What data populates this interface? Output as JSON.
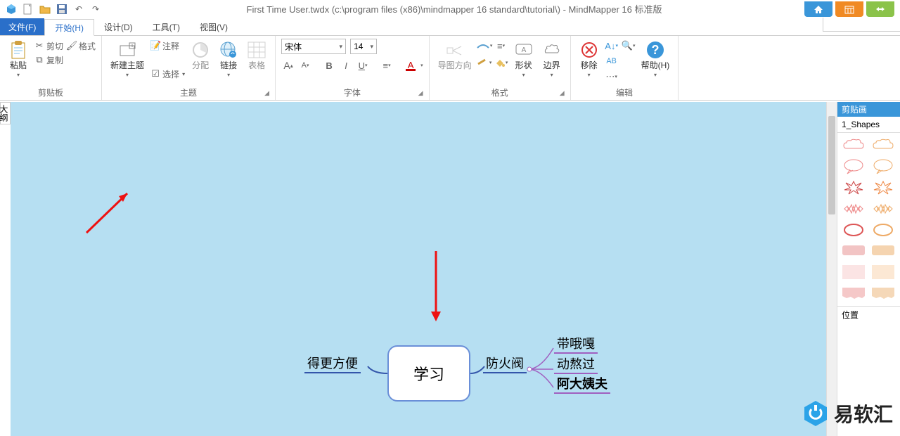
{
  "title": "First Time User.twdx (c:\\program files (x86)\\mindmapper 16 standard\\tutorial\\) - MindMapper 16 标准版",
  "tabs": {
    "file": "文件(F)",
    "home": "开始(H)",
    "design": "设计(D)",
    "tools": "工具(T)",
    "view": "视图(V)"
  },
  "groups": {
    "clipboard": "剪贴板",
    "topic": "主题",
    "font": "字体",
    "format": "格式",
    "edit": "编辑"
  },
  "btn": {
    "paste": "粘贴",
    "cut": "剪切",
    "copy": "复制",
    "fmtpaint": "格式",
    "newtopic": "新建主题",
    "select": "选择",
    "comment": "注释",
    "assign": "分配",
    "link": "链接",
    "table": "表格",
    "direction": "导图方向",
    "shape": "形状",
    "border": "边界",
    "remove": "移除",
    "help": "帮助(H)"
  },
  "font": {
    "name": "宋体",
    "size": "14"
  },
  "rightpanel": {
    "title": "剪贴画",
    "category": "1_Shapes",
    "pos": "位置"
  },
  "outline": "大纲",
  "mindmap": {
    "central": "学习",
    "left": "得更方便",
    "r1": "防火阀",
    "r1a": "带哦嘎",
    "r1b": "动熬过",
    "r1c": "阿大姨夫"
  },
  "logo": "易软汇"
}
